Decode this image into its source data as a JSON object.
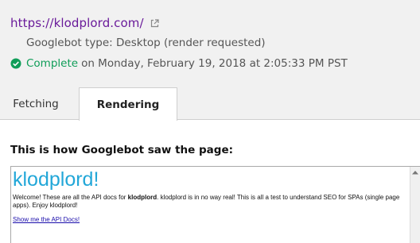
{
  "header": {
    "url": "https://klodplord.com/",
    "googlebot_type": "Googlebot type: Desktop (render requested)",
    "status": {
      "word": "Complete",
      "detail": "on Monday, February 19, 2018 at 2:05:33 PM PST",
      "color": "#0f9d58"
    },
    "icons": {
      "external": "external-link-icon",
      "status": "check-circle-icon"
    }
  },
  "tabs": [
    {
      "label": "Fetching",
      "active": false
    },
    {
      "label": "Rendering",
      "active": true
    }
  ],
  "main": {
    "section_title": "This is how Googlebot saw the page:",
    "rendered_page": {
      "title": "klodplord!",
      "text_before": "Welcome! These are all the API docs for ",
      "text_bold": "klodplord",
      "text_after": ". klodplord is in no way real! This is all a test to understand SEO for SPAs (single page apps). Enjoy klodplord!",
      "link": "Show me the API Docs!"
    }
  },
  "colors": {
    "url": "#6a1b9a",
    "site_title": "#22a7d8",
    "link": "#1a0dab",
    "header_bg": "#f1f1f1"
  }
}
